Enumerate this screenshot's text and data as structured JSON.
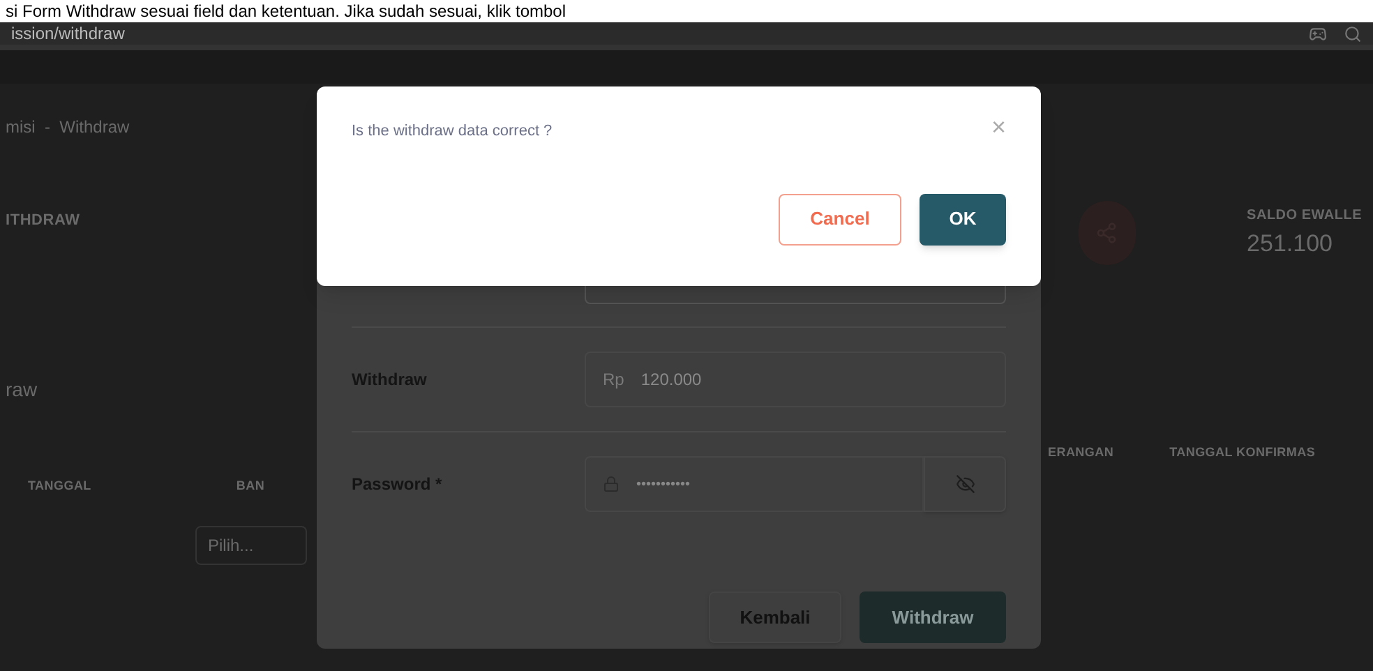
{
  "instruction": "si Form Withdraw sesuai field dan ketentuan. Jika sudah sesuai, klik tombol",
  "address_bar": {
    "url": "ission/withdraw"
  },
  "background": {
    "breadcrumb": "misi  -  Withdraw",
    "section_title": "ITHDRAW",
    "balance_label": "SALDO EWALLE",
    "balance_value": "251.100",
    "history_title": "raw",
    "columns": [
      "TANGGAL",
      "BAN",
      "ERANGAN",
      "TANGGAL KONFIRMAS"
    ],
    "filter_placeholder": "Pilih..."
  },
  "form_dialog": {
    "fields": [
      {
        "label": "Withdraw",
        "kind": "amount",
        "prefix": "Rp",
        "value": "120.000"
      },
      {
        "label": "Password *",
        "kind": "password",
        "value": "•••••••••••"
      }
    ],
    "buttons": [
      {
        "label": "Kembali",
        "kind": "secondary"
      },
      {
        "label": "Withdraw",
        "kind": "primary"
      }
    ]
  },
  "confirm_dialog": {
    "message": "Is the withdraw data correct ?",
    "close": "×",
    "buttons": [
      {
        "label": "Cancel",
        "kind": "secondary"
      },
      {
        "label": "OK",
        "kind": "primary"
      }
    ]
  }
}
